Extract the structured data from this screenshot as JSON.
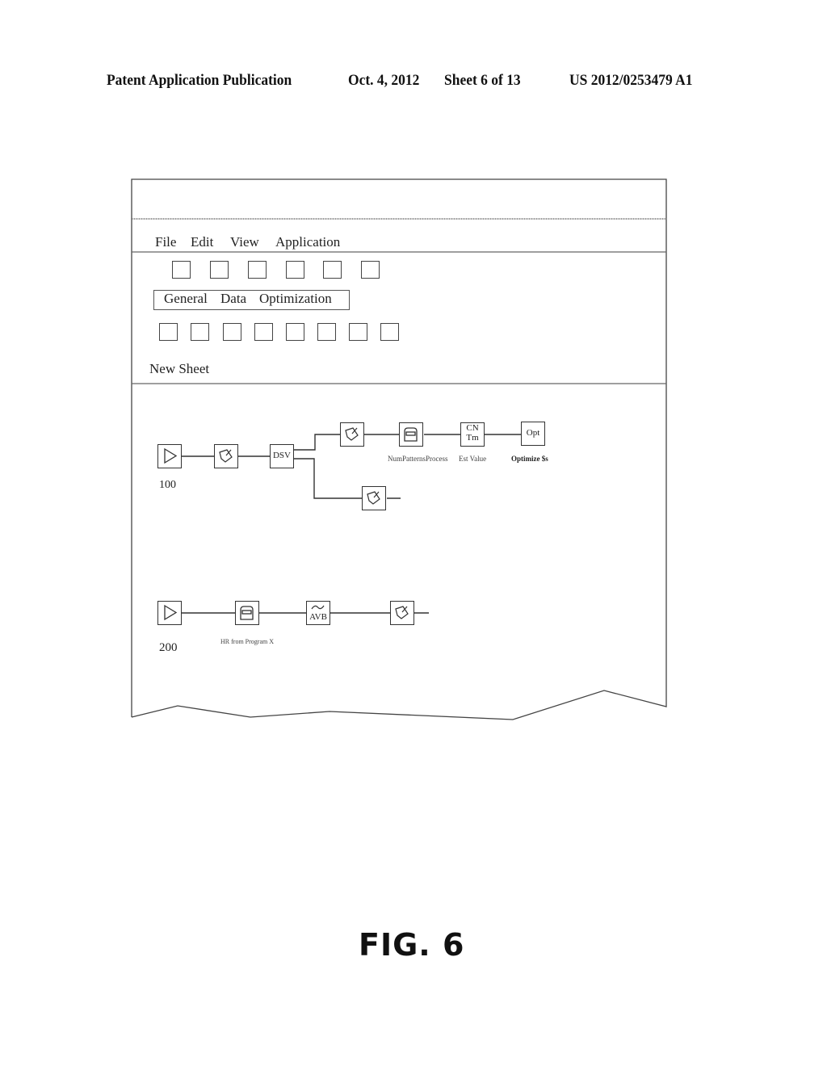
{
  "page_header": {
    "publication": "Patent Application Publication",
    "date": "Oct. 4, 2012",
    "sheet": "Sheet 6 of 13",
    "number": "US 2012/0253479 A1"
  },
  "window": {
    "title": "",
    "menu": [
      "File",
      "Edit",
      "View",
      "Application"
    ],
    "toolbar_row1_button_count": 6,
    "tabs": [
      "General",
      "Data",
      "Optimization"
    ],
    "toolbar_row2_button_count": 8,
    "sheet_name": "New Sheet"
  },
  "workflow_100": {
    "id": "100",
    "nodes": [
      {
        "name": "source",
        "icon": "play-triangle-icon",
        "text": "",
        "label": ""
      },
      {
        "name": "transform",
        "icon": "pencil-tag-icon",
        "text": "",
        "label": ""
      },
      {
        "name": "dsv",
        "icon": "",
        "text": "DSV",
        "label": ""
      },
      {
        "name": "branch-upper-transform",
        "icon": "pencil-tag-icon",
        "text": "",
        "label": ""
      },
      {
        "name": "num-patterns-process",
        "icon": "database-drawer-icon",
        "text": "",
        "label": "NumPatternsProcess"
      },
      {
        "name": "est-value",
        "icon": "",
        "text": "CN\nTm",
        "text_lines": [
          "CN",
          "Tm"
        ],
        "label": "Est Value"
      },
      {
        "name": "optimize",
        "icon": "",
        "text": "Opt",
        "label": "Optimize $s"
      },
      {
        "name": "branch-lower-transform",
        "icon": "pencil-tag-icon",
        "text": "",
        "label": ""
      }
    ]
  },
  "workflow_200": {
    "id": "200",
    "nodes": [
      {
        "name": "source",
        "icon": "play-triangle-icon",
        "text": "",
        "label": ""
      },
      {
        "name": "hr-from-program-x",
        "icon": "database-drawer-icon",
        "text": "",
        "label": "HR from Program X"
      },
      {
        "name": "avb",
        "icon": "wave-icon",
        "text": "AVB",
        "label": ""
      },
      {
        "name": "transform",
        "icon": "pencil-tag-icon",
        "text": "",
        "label": ""
      }
    ]
  },
  "figure_caption": "FIG. 6"
}
